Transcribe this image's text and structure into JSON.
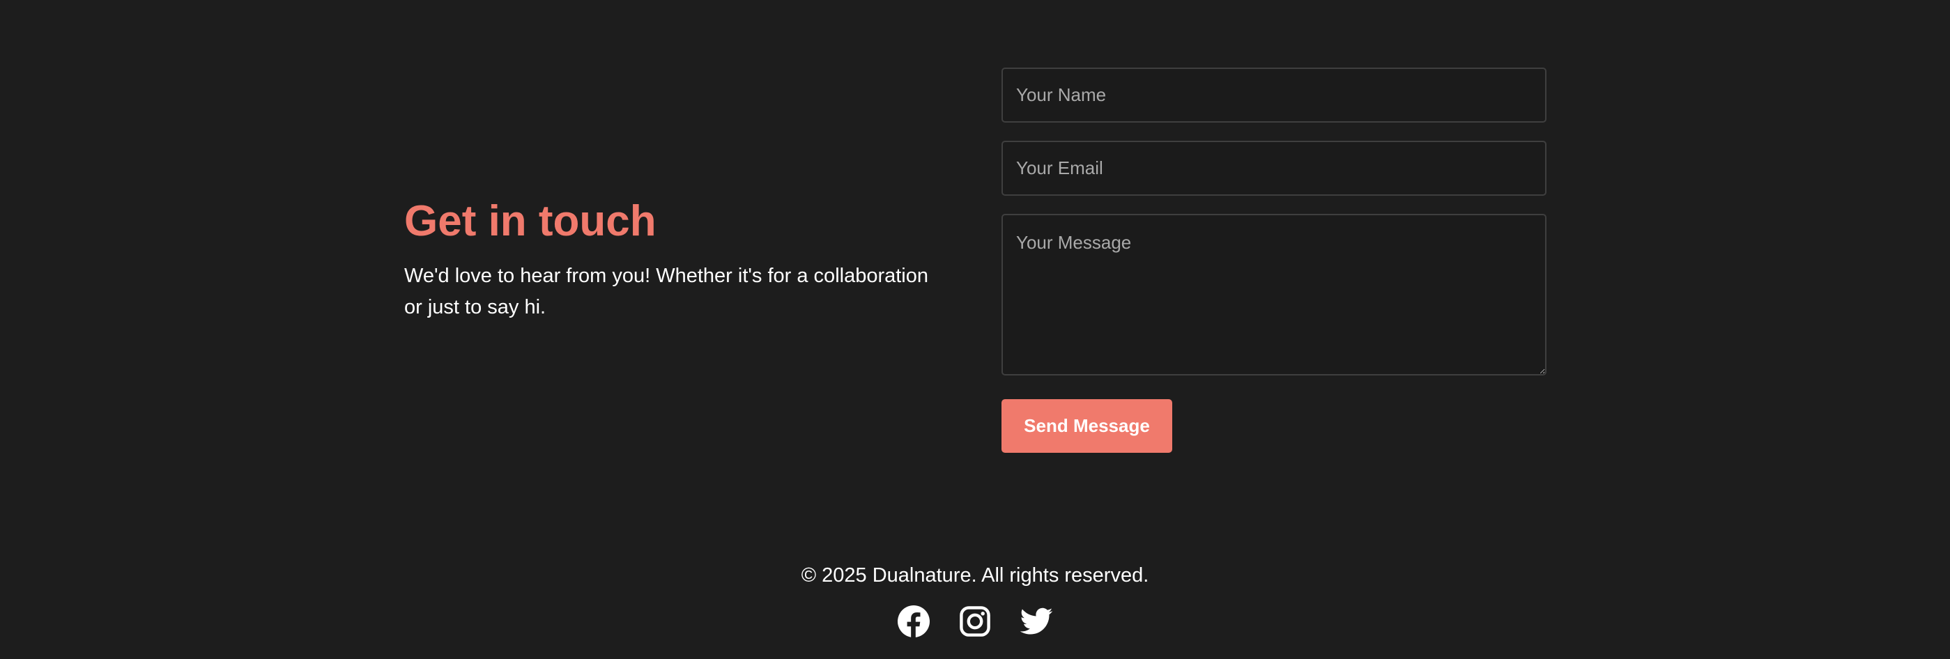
{
  "contact": {
    "heading": "Get in touch",
    "description": "We'd love to hear from you! Whether it's for a collaboration or just to say hi."
  },
  "form": {
    "name_placeholder": "Your Name",
    "email_placeholder": "Your Email",
    "message_placeholder": "Your Message",
    "submit_label": "Send Message"
  },
  "footer": {
    "copyright": "© 2025 Dualnature. All rights reserved.",
    "socials": [
      {
        "icon": "facebook-icon"
      },
      {
        "icon": "instagram-icon"
      },
      {
        "icon": "twitter-icon"
      }
    ]
  },
  "colors": {
    "background": "#1d1d1d",
    "accent": "#f07a6c",
    "text": "#ffffff",
    "placeholder": "#a9a9a9",
    "field_border": "#3f3f3f"
  }
}
